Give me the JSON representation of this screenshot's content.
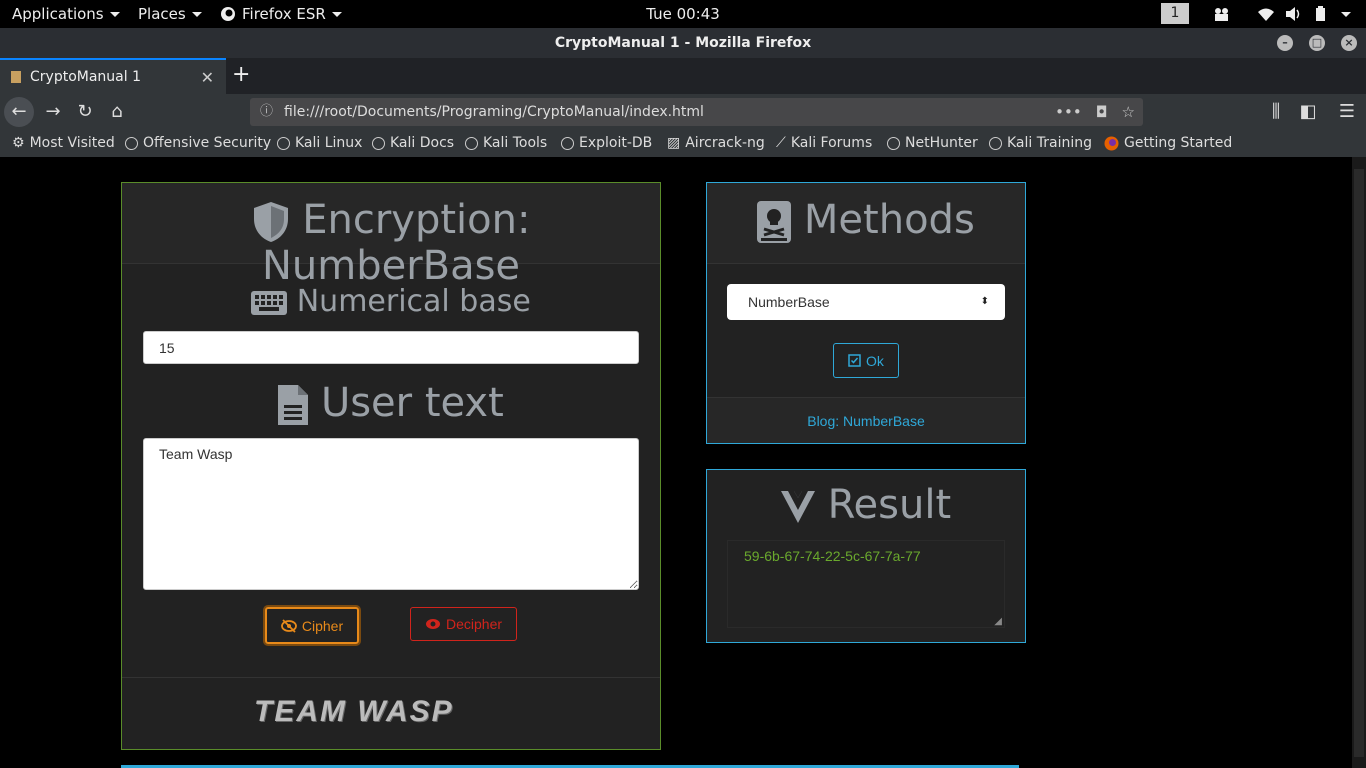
{
  "system_bar": {
    "applications": "Applications",
    "places": "Places",
    "firefox": "Firefox ESR",
    "clock": "Tue 00:43",
    "workspace": "1"
  },
  "window": {
    "title": "CryptoManual 1 - Mozilla Firefox"
  },
  "tab": {
    "label": "CryptoManual 1"
  },
  "url": "file:///root/Documents/Programing/CryptoManual/index.html",
  "bookmarks": [
    "Most Visited",
    "Offensive Security",
    "Kali Linux",
    "Kali Docs",
    "Kali Tools",
    "Exploit-DB",
    "Aircrack-ng",
    "Kali Forums",
    "NetHunter",
    "Kali Training",
    "Getting Started"
  ],
  "main_card": {
    "title": "Encryption: NumberBase",
    "base_heading": "Numerical base",
    "base_value": "15",
    "text_heading": "User text",
    "text_value": "Team Wasp",
    "cipher_label": "Cipher",
    "decipher_label": "Decipher",
    "logo_text": "TEAM WASP"
  },
  "methods_card": {
    "title": "Methods",
    "selected": "NumberBase",
    "ok_label": "Ok",
    "blog_link": "Blog: NumberBase"
  },
  "result_card": {
    "title": "Result",
    "output": "59-6b-67-74-22-5c-67-7a-77"
  },
  "colors": {
    "accent_green": "#5a8c2a",
    "accent_blue": "#2fa8d8",
    "cipher_orange": "#e88a1a",
    "decipher_red": "#d0241c",
    "result_text": "#6aa92d"
  }
}
